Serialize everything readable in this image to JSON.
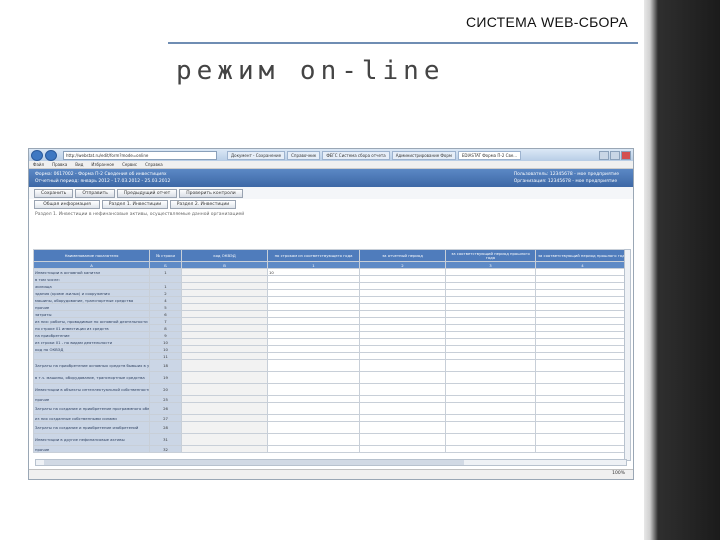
{
  "slide": {
    "header": "СИСТЕМА WEB-СБОРА",
    "title": "режим on-line"
  },
  "browser": {
    "address": "http://webstat.ru/edit/form?mode=online",
    "tabs": [
      {
        "label": "Документ - Сохранение"
      },
      {
        "label": "Справочник"
      },
      {
        "label": "ФЕГС Система сбора отчета"
      },
      {
        "label": "Администрирование Форм"
      },
      {
        "label": "EDIASTAT Форма П-2 Све..."
      }
    ],
    "menu": [
      "Файл",
      "Правка",
      "Вид",
      "Избранное",
      "Сервис",
      "Справка"
    ],
    "zoom": "100%"
  },
  "form_header": {
    "left_line1": "Форма: 0617002 - Форма П-2 Сведения об инвестициях",
    "left_line2": "Отчетный период: январь 2012 - 17.03.2012 - 25.03.2012",
    "right_line1": "Пользователь: 12345678 - мое предприятие",
    "right_line2": "Организация: 12345678 - мое предприятие"
  },
  "toolbar": {
    "buttons": [
      "Сохранить",
      "Отправить",
      "Предыдущий отчет",
      "Проверить контроли"
    ]
  },
  "section_tabs": [
    "Общая информация",
    "Раздел 1. Инвестиции",
    "Раздел 2. Инвестиции"
  ],
  "section_name": "Раздел 1. Инвестиции в нефинансовые активы, осуществляемые данной организацией",
  "grid": {
    "headers": [
      "Наименование показателя",
      "№ строки",
      "код ОКВЭД",
      "по строкам из соответствующего года",
      "за отчетный период",
      "за соответствующий период прошлого года",
      "за соответствующий период прошлого года"
    ],
    "col_nums": [
      "А",
      "Б",
      "В",
      "1",
      "2",
      "3",
      "4"
    ],
    "rows": [
      {
        "name": "Инвестиции в основной капитал",
        "code": "1",
        "v1": "10"
      },
      {
        "name": "в том числе:",
        "code": ""
      },
      {
        "name": "жилища",
        "code": "1"
      },
      {
        "name": "здания (кроме жилых) и сооружения",
        "code": "2"
      },
      {
        "name": "машины, оборудование, транспортные средства",
        "code": "4"
      },
      {
        "name": "прочие",
        "code": "5"
      },
      {
        "name": "затраты",
        "code": "6"
      },
      {
        "name": "из них: работы, проводимые по основной деятельности",
        "code": "7"
      },
      {
        "name": "по строке 01 инвестиции из средств",
        "code": "8"
      },
      {
        "name": "на приобретение",
        "code": "9"
      },
      {
        "name": "из строки 01 - по видам деятельности",
        "code": "10"
      },
      {
        "name": "код по ОКВЭД",
        "code": "10"
      },
      {
        "name": "",
        "code": "11"
      },
      {
        "name": "Затраты на приобретение основных средств бывших в употреблении у других организаций",
        "code": "18"
      },
      {
        "name": "в т.ч. машины, оборудование, транспортные средства",
        "code": "19"
      },
      {
        "name": "Инвестиции в объекты интеллектуальной собственности",
        "code": "20"
      },
      {
        "name": "прочие",
        "code": "25"
      },
      {
        "name": "Затраты на создание и приобретение программного обеспечения",
        "code": "26"
      },
      {
        "name": "из них созданные собственными силами",
        "code": "27"
      },
      {
        "name": "Затраты на создание и приобретение изобретений",
        "code": "28"
      },
      {
        "name": "Инвестиции в другие нефинансовые активы",
        "code": "31"
      },
      {
        "name": "прочие",
        "code": "32"
      }
    ]
  }
}
